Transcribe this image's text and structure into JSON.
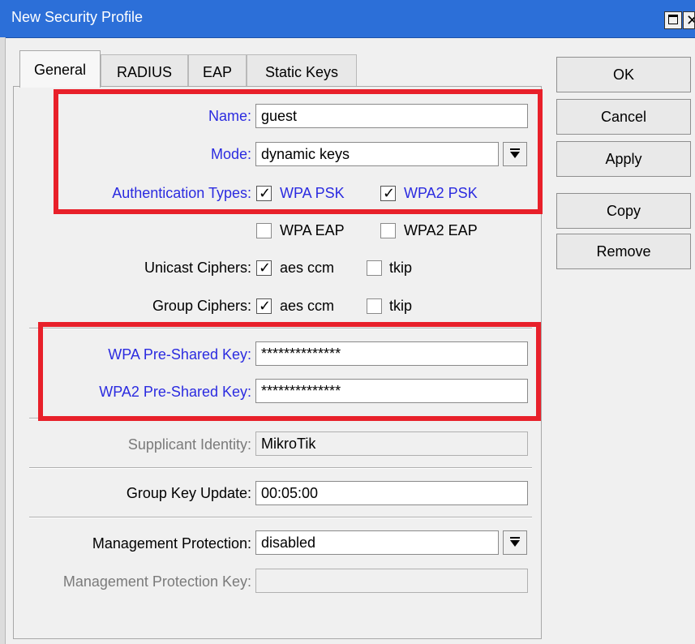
{
  "window": {
    "title": "New Security Profile"
  },
  "tabs": [
    "General",
    "RADIUS",
    "EAP",
    "Static Keys"
  ],
  "buttons": {
    "ok": "OK",
    "cancel": "Cancel",
    "apply": "Apply",
    "copy": "Copy",
    "remove": "Remove"
  },
  "form": {
    "name_label": "Name:",
    "name_value": "guest",
    "mode_label": "Mode:",
    "mode_value": "dynamic keys",
    "auth_types_label": "Authentication Types:",
    "auth_types": [
      {
        "label": "WPA PSK",
        "checked": true
      },
      {
        "label": "WPA2 PSK",
        "checked": true
      },
      {
        "label": "WPA EAP",
        "checked": false
      },
      {
        "label": "WPA2 EAP",
        "checked": false
      }
    ],
    "unicast_label": "Unicast Ciphers:",
    "unicast": [
      {
        "label": "aes ccm",
        "checked": true
      },
      {
        "label": "tkip",
        "checked": false
      }
    ],
    "group_label": "Group Ciphers:",
    "group": [
      {
        "label": "aes ccm",
        "checked": true
      },
      {
        "label": "tkip",
        "checked": false
      }
    ],
    "wpa_psk_label": "WPA Pre-Shared Key:",
    "wpa_psk_value": "**************",
    "wpa2_psk_label": "WPA2 Pre-Shared Key:",
    "wpa2_psk_value": "**************",
    "supplicant_label": "Supplicant Identity:",
    "supplicant_value": "MikroTik",
    "group_key_update_label": "Group Key Update:",
    "group_key_update_value": "00:05:00",
    "mgmt_protection_label": "Management Protection:",
    "mgmt_protection_value": "disabled",
    "mgmt_protection_key_label": "Management Protection Key:",
    "mgmt_protection_key_value": ""
  },
  "colors": {
    "titlebar": "#2c6fd8",
    "highlight": "#e8202a",
    "blue_label": "#2b2be0"
  }
}
